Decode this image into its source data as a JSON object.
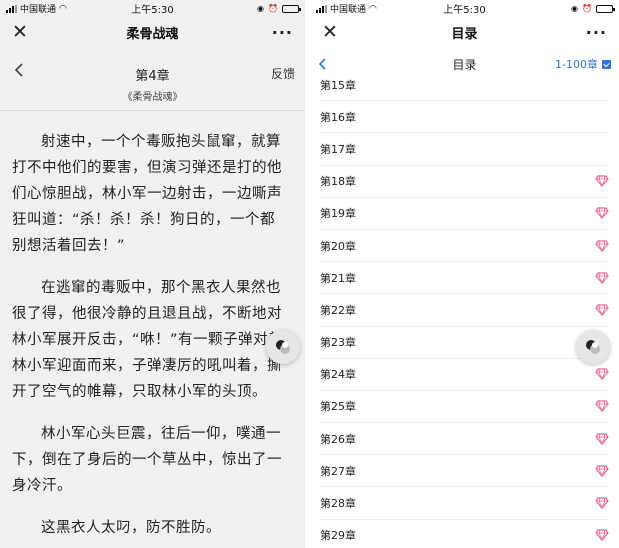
{
  "status": {
    "carrier": "中国联通",
    "time": "上午5:30"
  },
  "reader": {
    "nav_title": "柔骨战魂",
    "chapter_title": "第4章",
    "book_name": "《柔骨战魂》",
    "feedback_label": "反馈",
    "paragraphs": [
      "射速中，一个个毒贩抱头鼠窜，就算打不中他们的要害，但演习弹还是打的他们心惊胆战，林小军一边射击，一边嘶声狂叫道：“杀！杀！杀！狗日的，一个都别想活着回去！”",
      "在逃窜的毒贩中，那个黑衣人果然也很了得，他很冷静的且退且战，不断地对林小军展开反击，“咻！”有一颗子弹对着林小军迎面而来，子弹凄厉的吼叫着，撕开了空气的帷幕，只取林小军的头顶。",
      "林小军心头巨震，往后一仰，噗通一下，倒在了身后的一个草丛中，惊出了一身冷汗。",
      "这黑衣人太叼，防不胜防。"
    ]
  },
  "toc": {
    "nav_title": "目录",
    "header_title": "目录",
    "range_label": "1-100章",
    "items": [
      {
        "label": "第15章",
        "vip": false
      },
      {
        "label": "第16章",
        "vip": false
      },
      {
        "label": "第17章",
        "vip": false
      },
      {
        "label": "第18章",
        "vip": true
      },
      {
        "label": "第19章",
        "vip": true
      },
      {
        "label": "第20章",
        "vip": true
      },
      {
        "label": "第21章",
        "vip": true
      },
      {
        "label": "第22章",
        "vip": true
      },
      {
        "label": "第23章",
        "vip": true
      },
      {
        "label": "第24章",
        "vip": true
      },
      {
        "label": "第25章",
        "vip": true
      },
      {
        "label": "第26章",
        "vip": true
      },
      {
        "label": "第27章",
        "vip": true
      },
      {
        "label": "第28章",
        "vip": true
      },
      {
        "label": "第29章",
        "vip": true
      }
    ]
  },
  "colors": {
    "accent_blue": "#2e74d6",
    "gem_pink": "#f06292",
    "reader_bg": "#f1f1f1"
  },
  "icons": {
    "close": "close-icon",
    "more": "more-icon",
    "back": "chevron-left-icon",
    "vip": "diamond-icon",
    "assistant": "floating-assistant-icon"
  }
}
